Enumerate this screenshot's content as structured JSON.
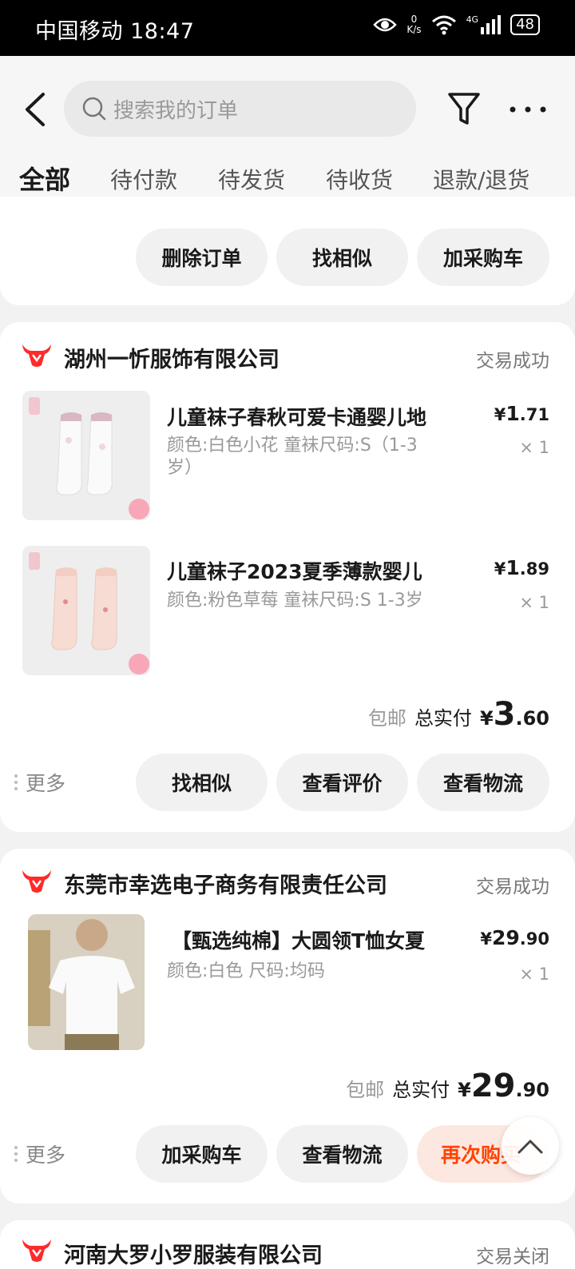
{
  "status_bar": {
    "carrier_time": "中国移动 18:47",
    "speed_value": "0",
    "speed_unit": "K/s",
    "network": "4G",
    "battery": "48"
  },
  "search": {
    "placeholder": "搜索我的订单"
  },
  "icons": {
    "back": "back-arrow-icon",
    "search": "search-icon",
    "filter": "filter-icon",
    "more": "more-icon",
    "shop": "shop-logo-icon",
    "scroll_top": "chevron-up-icon"
  },
  "tabs": [
    "全部",
    "待付款",
    "待发货",
    "待收货",
    "退款/退货"
  ],
  "colors": {
    "accent": "#ff4400",
    "shop_logo": "#ff2a2a"
  },
  "partial_order": {
    "buttons": [
      "删除订单",
      "找相似",
      "加采购车"
    ]
  },
  "orders": [
    {
      "shop": "湖州一忻服饰有限公司",
      "status": "交易成功",
      "items": [
        {
          "name": "儿童袜子春秋可爱卡通婴儿地",
          "spec": "颜色:白色小花 童袜尺码:S（1-3岁）",
          "price_symbol": "¥",
          "price_int": "1",
          "price_dec": ".71",
          "qty": "× 1"
        },
        {
          "name": "儿童袜子2023夏季薄款婴儿",
          "spec": "颜色:粉色草莓 童袜尺码:S 1-3岁",
          "price_symbol": "¥",
          "price_int": "1",
          "price_dec": ".89",
          "qty": "× 1"
        }
      ],
      "shipping": "包邮",
      "total_label": "总实付",
      "total_symbol": "¥",
      "total_int": "3",
      "total_dec": ".60",
      "more": "更多",
      "buttons": [
        "找相似",
        "查看评价",
        "查看物流"
      ]
    },
    {
      "shop": "东莞市幸选电子商务有限责任公司",
      "status": "交易成功",
      "items": [
        {
          "name": "【甄选纯棉】大圆领T恤女夏",
          "spec": "颜色:白色 尺码:均码",
          "price_symbol": "¥",
          "price_int": "29",
          "price_dec": ".90",
          "qty": "× 1"
        }
      ],
      "shipping": "包邮",
      "total_label": "总实付",
      "total_symbol": "¥",
      "total_int": "29",
      "total_dec": ".90",
      "more": "更多",
      "buttons": [
        "加采购车",
        "查看物流",
        "再次购买"
      ]
    },
    {
      "shop": "河南大罗小罗服装有限公司",
      "status": "交易关闭"
    }
  ]
}
